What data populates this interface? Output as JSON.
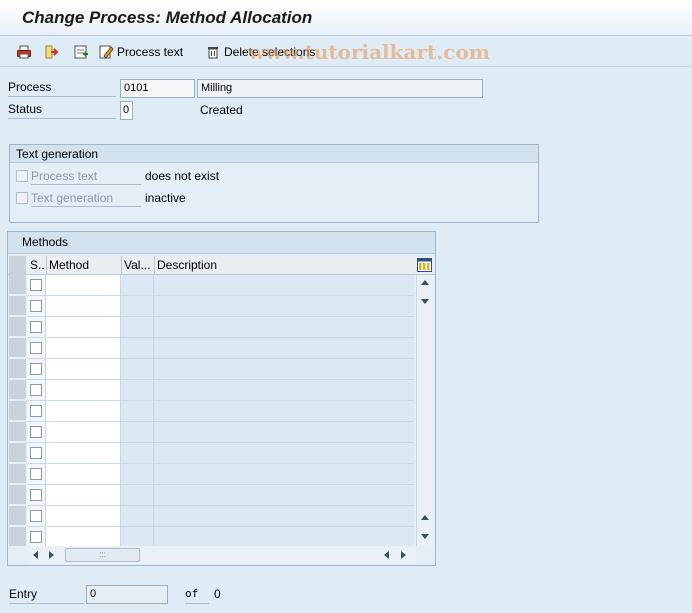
{
  "title": "Change Process: Method Allocation",
  "toolbar": {
    "process_text_label": "Process text",
    "delete_selections_label": "Delete selections"
  },
  "watermark": "www.tutorialkart.com",
  "header": {
    "process_label": "Process",
    "process_value": "0101",
    "process_desc": "Milling",
    "status_label": "Status",
    "status_value": "0",
    "status_text": "Created"
  },
  "text_generation": {
    "title": "Text generation",
    "process_text_label": "Process text",
    "process_text_value": "does not exist",
    "text_generation_label": "Text generation",
    "text_generation_value": "inactive"
  },
  "methods": {
    "title": "Methods",
    "columns": [
      "S..",
      "Method",
      "Val...",
      "Description"
    ],
    "row_count": 13
  },
  "footer": {
    "entry_label": "Entry",
    "entry_value": "0",
    "of_label": "of",
    "total_value": "0"
  },
  "icons": {
    "toolbar": [
      "print-icon",
      "exit-arrow-icon",
      "new-entries-icon",
      "edit-text-icon",
      "trash-icon"
    ],
    "table": [
      "column-settings-icon"
    ]
  },
  "colors": {
    "background": "#dfebf5",
    "watermark": "#e69650",
    "header_bar": "#d3e2ef"
  }
}
